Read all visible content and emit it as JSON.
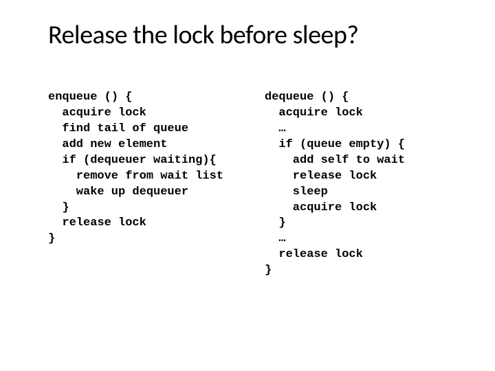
{
  "title": "Release the lock before sleep?",
  "left": {
    "l0": "enqueue () {",
    "l1": "acquire lock",
    "l2": "find tail of queue",
    "l3": "add new element",
    "l4": "if (dequeuer waiting){",
    "l5": "remove from wait list",
    "l6": "wake up dequeuer",
    "l7": "}",
    "l8": "release lock",
    "l9": "}"
  },
  "right": {
    "l0": "dequeue () {",
    "l1": "acquire lock",
    "l2": "…",
    "l3": "if (queue empty) {",
    "l4": "add self to wait",
    "l5": "release lock",
    "l6": "sleep",
    "l7": "acquire lock",
    "l8": "}",
    "l9": "…",
    "l10": "release lock",
    "l11": "}"
  }
}
